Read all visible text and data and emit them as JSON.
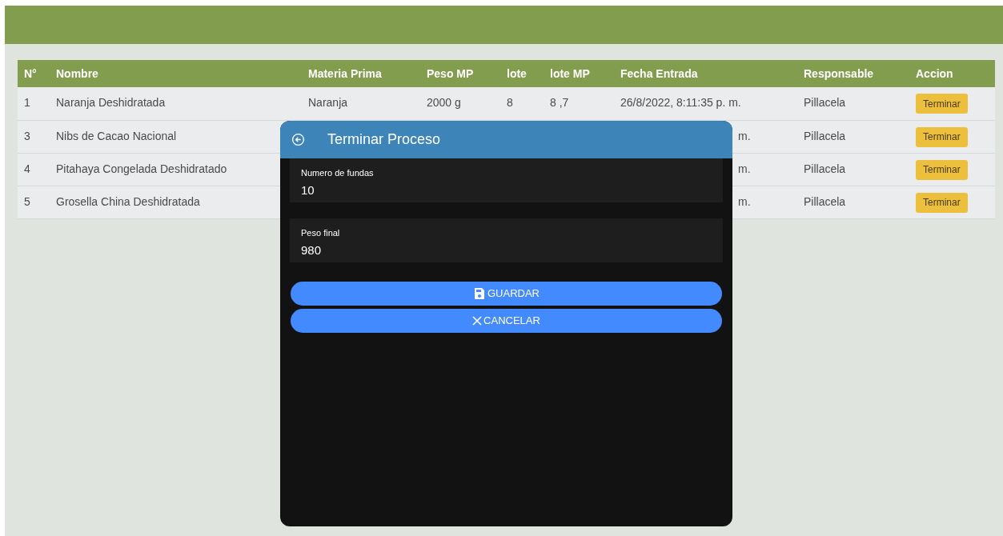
{
  "table": {
    "columns": [
      "N°",
      "Nombre",
      "Materia Prima",
      "Peso MP",
      "lote",
      "lote MP",
      "Fecha Entrada",
      "Responsable",
      "Accion"
    ],
    "rows": [
      {
        "kind": "full",
        "cells": [
          "1",
          "Naranja Deshidratada",
          "Naranja",
          "2000 g",
          "8",
          "8 ,7",
          "26/8/2022, 8:11:35 p. m.",
          "Pillacela"
        ],
        "action": "Terminar"
      },
      {
        "kind": "covered",
        "cells": [
          "3",
          "Nibs de Cacao Nacional",
          "",
          "",
          "",
          "",
          "m.",
          "Pillacela"
        ],
        "action": "Terminar"
      },
      {
        "kind": "covered",
        "cells": [
          "4",
          "Pitahaya Congelada Deshidratado",
          "",
          "",
          "",
          "",
          "m.",
          "Pillacela"
        ],
        "action": "Terminar"
      },
      {
        "kind": "covered",
        "cells": [
          "5",
          "Grosella China Deshidratada",
          "",
          "",
          "",
          "",
          "m.",
          "Pillacela"
        ],
        "action": "Terminar"
      }
    ]
  },
  "dialog": {
    "title": "Terminar Proceso",
    "fields": [
      {
        "label": "Numero de fundas",
        "value": "10"
      },
      {
        "label": "Peso final",
        "value": "980"
      }
    ],
    "buttons": [
      {
        "kind": "save",
        "label": "GUARDAR"
      },
      {
        "kind": "cancel",
        "label": "CANCELAR"
      }
    ]
  }
}
